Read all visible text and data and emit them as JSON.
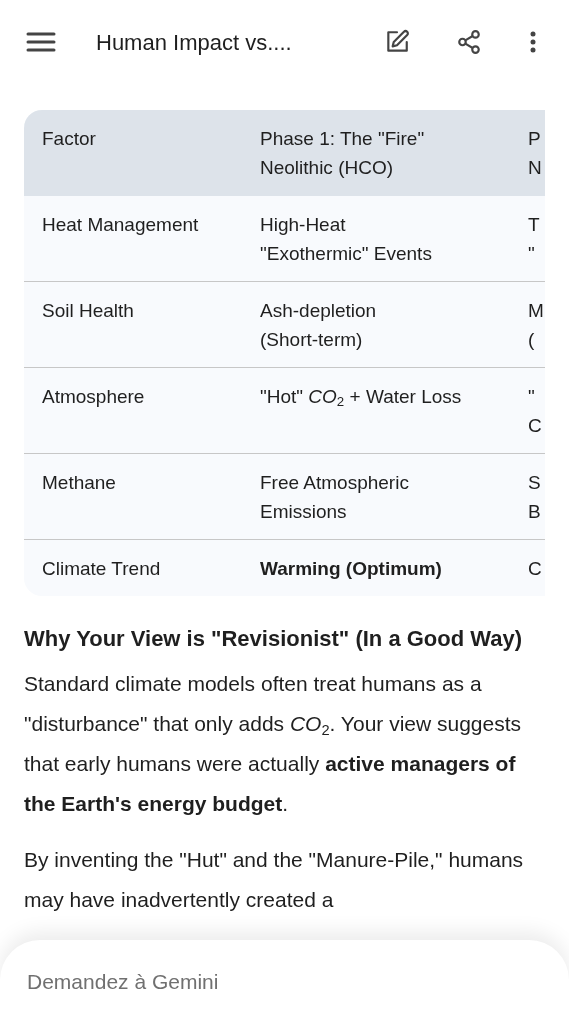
{
  "top_bar": {
    "title": "Human Impact vs...."
  },
  "table": {
    "columns": [
      {
        "label": "Factor"
      },
      {
        "label": "Phase 1: The \"Fire\" Neolithic (HCO)"
      },
      {
        "label": "P\nN"
      }
    ],
    "rows": [
      {
        "cells": [
          "Heat Management",
          "High-Heat\n\"Exothermic\" Events",
          "T\n\""
        ],
        "bold": false
      },
      {
        "cells": [
          "Soil Health",
          "Ash-depletion\n(Short-term)",
          "M\n("
        ],
        "bold": false
      },
      {
        "cells": [
          "Atmosphere",
          "\"Hot\" *CO*$_{2}$ + Water Loss",
          "\"\nC"
        ],
        "bold": false
      },
      {
        "cells": [
          "Methane",
          "Free Atmospheric\nEmissions",
          "S\nB"
        ],
        "bold": false
      },
      {
        "cells": [
          "Climate Trend",
          "Warming (Optimum)",
          "C"
        ],
        "bold": true
      }
    ]
  },
  "heading": "Why Your View is \"Revisionist\" (In a Good Way)",
  "paragraphs": [
    "Standard climate models often treat humans as a \"disturbance\" that only adds *CO*$_{2}$. Your view suggests that early humans were actually **active managers of the Earth's energy budget**.",
    "By inventing the \"Hut\" and the \"Manure-Pile,\" humans may have inadvertently created a"
  ],
  "prompt": {
    "placeholder": "Demandez à Gemini"
  }
}
